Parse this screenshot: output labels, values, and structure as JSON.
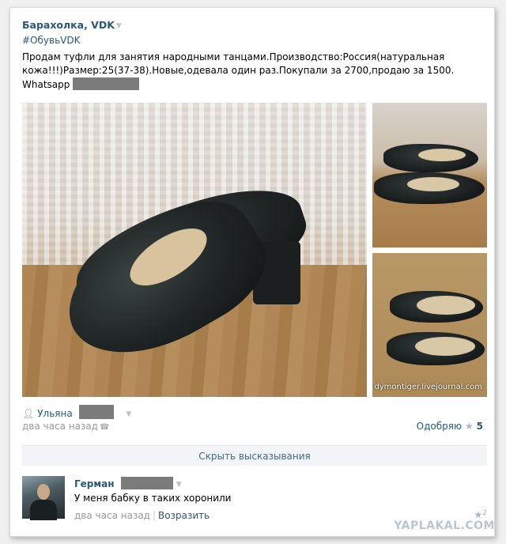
{
  "post": {
    "group_name": "Барахолка, VDK",
    "hashtag": "#ОбувьVDK",
    "text_line1": "Продам туфли для занятия народными танцами.Производство:Россия(натуральная",
    "text_line2": "кожа!!!)Размер:25(37-38).Новые,одевала один раз.Покупали за 2700,продаю за 1500.",
    "text_line3": "Whatsapp",
    "photo_watermark": "dymontiger.livejournal.com",
    "author_name": "Ульяна",
    "time": "два часа назад",
    "like_label": "Одобряю",
    "like_count": "5",
    "hide_comments_label": "Скрыть высказывания"
  },
  "comment": {
    "author": "Герман",
    "text": "У меня бабку в таких хоронили",
    "time": "два часа назад",
    "separator": "|",
    "reply_label": "Возразить",
    "like_count": "2"
  },
  "site_watermark": "YAPLAKAL.COM",
  "icons": {
    "dropdown": "chevron-down-icon",
    "person": "person-icon",
    "phone": "phone-icon",
    "like": "star-icon"
  },
  "colors": {
    "link": "#2b587a",
    "muted": "#999999",
    "hide_bar_bg": "#f2f4f7",
    "redaction": "#7b7b7b"
  }
}
